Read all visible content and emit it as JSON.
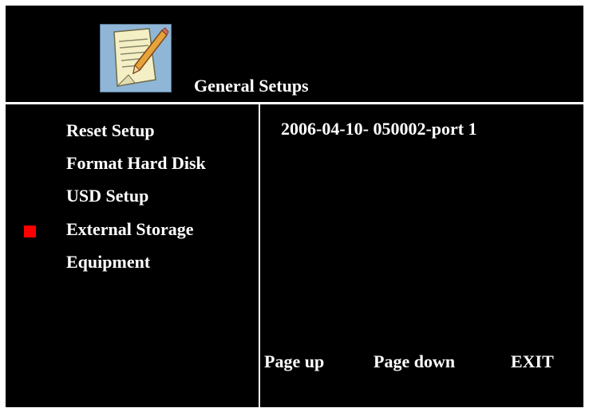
{
  "header": {
    "title": "General Setups",
    "icon": "notepad-pencil-icon"
  },
  "menu": {
    "items": [
      {
        "label": "Reset Setup",
        "selected": false
      },
      {
        "label": "Format Hard Disk",
        "selected": false
      },
      {
        "label": "USD Setup",
        "selected": false
      },
      {
        "label": "External Storage",
        "selected": true
      },
      {
        "label": "Equipment",
        "selected": false
      }
    ],
    "selection_marker_color": "#ff0000"
  },
  "content": {
    "files": [
      "2006-04-10- 050002-port 1"
    ]
  },
  "nav": {
    "page_up": "Page up",
    "page_down": "Page down",
    "exit": "EXIT"
  },
  "colors": {
    "background": "#000000",
    "text": "#ffffff",
    "border": "#ffffff",
    "accent": "#ff0000"
  }
}
